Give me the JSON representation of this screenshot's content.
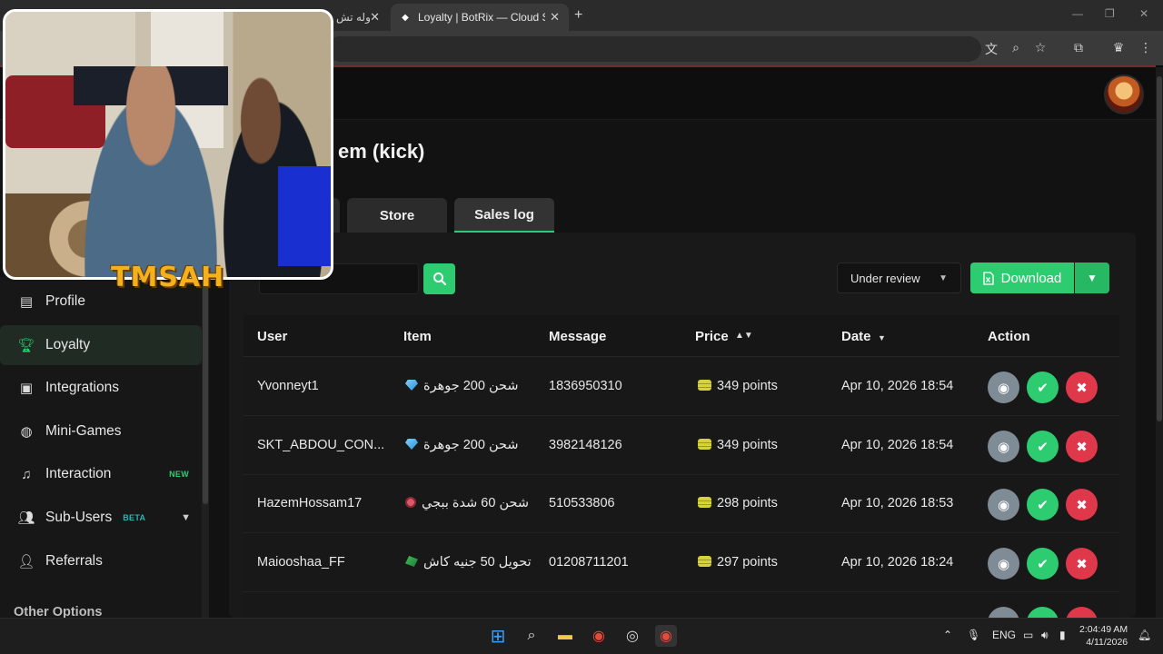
{
  "browser": {
    "tabs": [
      {
        "title": "جوله تش",
        "active": false
      },
      {
        "title": "Loyalty | BotRix — Cloud Stream",
        "active": true
      }
    ],
    "new_tab_glyph": "+"
  },
  "page": {
    "title_fragment": "em (kick)",
    "tabs": [
      "Store",
      "Sales log"
    ],
    "active_tab": "Sales log",
    "accent_color": "#2ecc71"
  },
  "toolbar": {
    "search_placeholder": "",
    "filter_value": "Under review",
    "download_label": "Download"
  },
  "table": {
    "headers": [
      "User",
      "Item",
      "Message",
      "Price",
      "Date",
      "Action"
    ],
    "rows": [
      {
        "user": "Yvonneyt1",
        "item": "شحن 200 جوهرة",
        "message": "1836950310",
        "price": "349 points",
        "date": "Apr 10, 2026 18:54"
      },
      {
        "user": "SKT_ABDOU_CON...",
        "item": "شحن 200 جوهرة",
        "message": "3982148126",
        "price": "349 points",
        "date": "Apr 10, 2026 18:54"
      },
      {
        "user": "HazemHossam17",
        "item": "شحن 60 شدة ببجي",
        "message": "510533806",
        "price": "298 points",
        "date": "Apr 10, 2026 18:53"
      },
      {
        "user": "Maiooshaa_FF",
        "item": "تحويل 50 جنيه كاش",
        "message": "01208711201",
        "price": "297 points",
        "date": "Apr 10, 2026 18:24"
      }
    ]
  },
  "sidebar": {
    "items": [
      {
        "label": "Profile",
        "icon": "id-card-icon"
      },
      {
        "label": "Loyalty",
        "icon": "trophy-icon",
        "active": true
      },
      {
        "label": "Integrations",
        "icon": "plug-icon"
      },
      {
        "label": "Mini-Games",
        "icon": "gamepad-icon"
      },
      {
        "label": "Interaction",
        "icon": "music-icon",
        "badge": "NEW"
      },
      {
        "label": "Sub-Users",
        "icon": "users-icon",
        "badge": "BETA"
      },
      {
        "label": "Referrals",
        "icon": "referrals-icon"
      }
    ],
    "other_options": "Other Options"
  },
  "webcam": {
    "logo_text": "TMSAH"
  },
  "taskbar": {
    "language": "ENG",
    "time": "2:04:49 AM",
    "date": "4/11/2026"
  }
}
